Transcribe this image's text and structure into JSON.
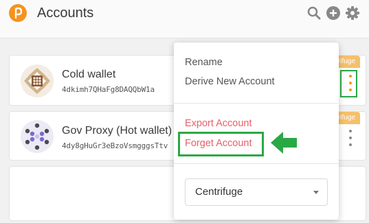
{
  "header": {
    "title": "Accounts",
    "logo_icon": "polkadot-logo-icon",
    "icons": [
      "search-icon",
      "add-icon",
      "gear-icon"
    ]
  },
  "accounts": [
    {
      "name": "Cold wallet",
      "address": "4dkimh7QHaFg8DAQQbW1a",
      "badge": "rifuge",
      "icon": "identicon-icon"
    },
    {
      "name": "Gov Proxy (Hot wallet)",
      "address": "4dy8gHuGr3eBzoVsmgggsTtv",
      "badge": "rifuge",
      "icon": "identicon-icon"
    }
  ],
  "menu": {
    "rename": "Rename",
    "derive": "Derive New Account",
    "export": "Export Account",
    "forget": "Forget Account",
    "network_select": {
      "value": "Centrifuge"
    }
  },
  "colors": {
    "accent": "#f5931e",
    "danger": "#e8606a",
    "highlight": "#2aa845",
    "badge": "#f5c06a"
  }
}
